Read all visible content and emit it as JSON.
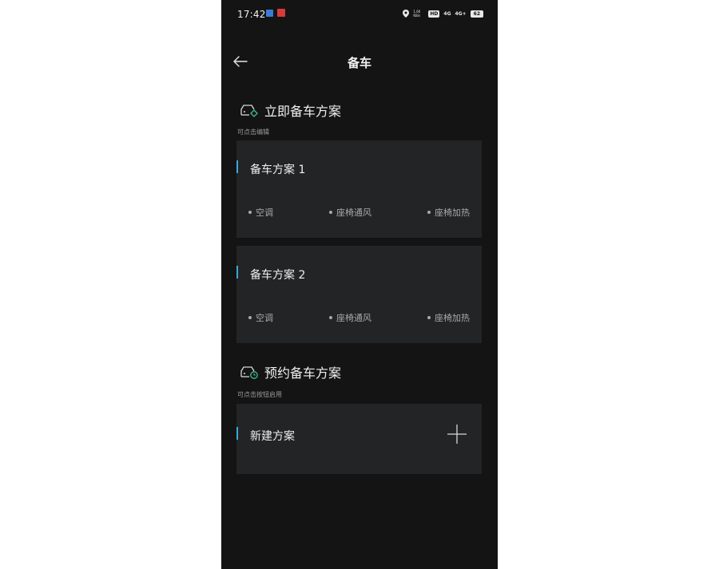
{
  "status_bar": {
    "time": "17:42",
    "net_speed": "1.60 KB/s",
    "hd_label": "HD",
    "signal1": "4G",
    "signal2": "4G+",
    "battery": "62"
  },
  "header": {
    "title": "备车"
  },
  "instant": {
    "title": "立即备车方案",
    "hint": "可点击编辑",
    "plans": [
      {
        "name": "备车方案 1",
        "features": [
          "空调",
          "座椅通风",
          "座椅加热"
        ]
      },
      {
        "name": "备车方案 2",
        "features": [
          "空调",
          "座椅通风",
          "座椅加热"
        ]
      }
    ]
  },
  "scheduled": {
    "title": "预约备车方案",
    "hint": "可点击按钮启用",
    "new_plan_label": "新建方案"
  },
  "colors": {
    "accent": "#3aa8d8",
    "card_bg": "#232425",
    "screen_bg": "#141414",
    "icon_green": "#3fbf8a"
  }
}
